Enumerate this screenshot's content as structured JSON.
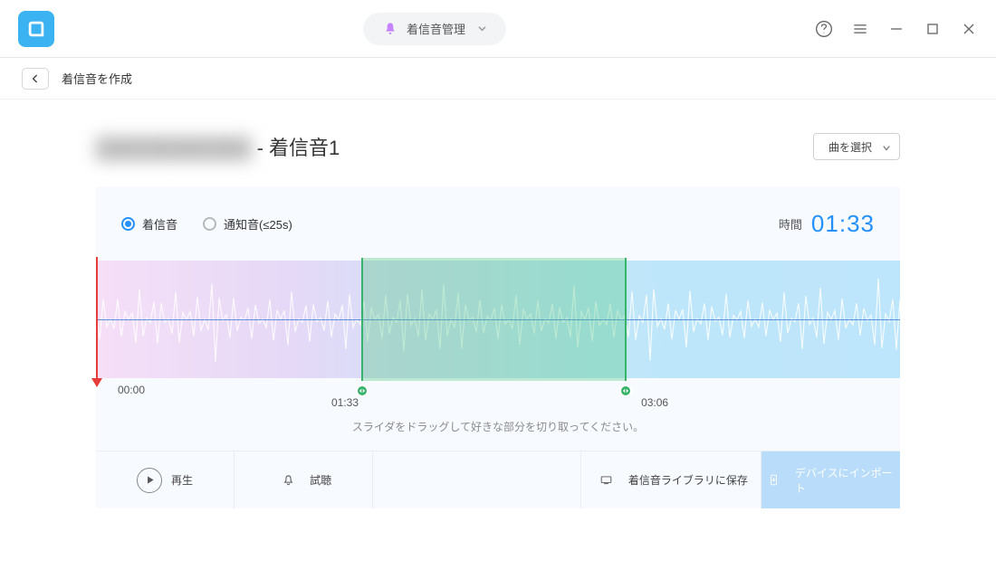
{
  "header": {
    "title": "着信音管理"
  },
  "nav": {
    "page_title": "着信音を作成"
  },
  "track": {
    "name_suffix": " - 着信音1",
    "select_button": "曲を選択"
  },
  "editor": {
    "radios": {
      "ringtone": "着信音",
      "notification": "通知音(≤25s)"
    },
    "time_label": "時間",
    "time_value": "01:33",
    "playhead_time": "00:00",
    "sel_start": "01:33",
    "sel_end": "03:06",
    "sel_start_pct": 33,
    "sel_end_pct": 66,
    "hint": "スライダをドラッグして好きな部分を切り取ってください。"
  },
  "actions": {
    "play": "再生",
    "preview": "試聴",
    "save_library": "着信音ライブラリに保存",
    "import_device": "デバイスにインポート"
  }
}
